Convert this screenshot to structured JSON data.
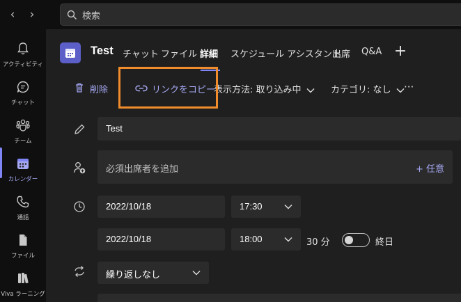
{
  "search": {
    "placeholder": "検索"
  },
  "rail": {
    "items": [
      {
        "label": "アクティビティ",
        "icon": "bell-icon"
      },
      {
        "label": "チャット",
        "icon": "chat-icon"
      },
      {
        "label": "チーム",
        "icon": "teams-icon"
      },
      {
        "label": "カレンダー",
        "icon": "calendar-icon",
        "active": true
      },
      {
        "label": "通話",
        "icon": "phone-icon"
      },
      {
        "label": "ファイル",
        "icon": "file-icon"
      },
      {
        "label": "Viva ラーニング",
        "icon": "book-icon"
      }
    ]
  },
  "header": {
    "title": "Test",
    "tabs": [
      "チャット",
      "ファイル",
      "詳細",
      "スケジュール アシスタント",
      "出席",
      "Q&A"
    ],
    "active_tab": "詳細"
  },
  "toolbar": {
    "delete_label": "削除",
    "copy_link_label": "リンクをコピー",
    "show_as_label": "表示方法: 取り込み中",
    "category_label": "カテゴリ: なし",
    "more_label": "···"
  },
  "form": {
    "title_value": "Test",
    "attendees_placeholder": "必須出席者を追加",
    "optional_label": "+ 任意",
    "start_date": "2022/10/18",
    "start_time": "17:30",
    "end_date": "2022/10/18",
    "end_time": "18:00",
    "duration": "30 分",
    "all_day_label": "終日",
    "all_day_on": false,
    "repeat_value": "繰り返しなし"
  },
  "colors": {
    "accent": "#7f85f5",
    "brand": "#5b5fc7",
    "highlight": "#f08c2c"
  }
}
